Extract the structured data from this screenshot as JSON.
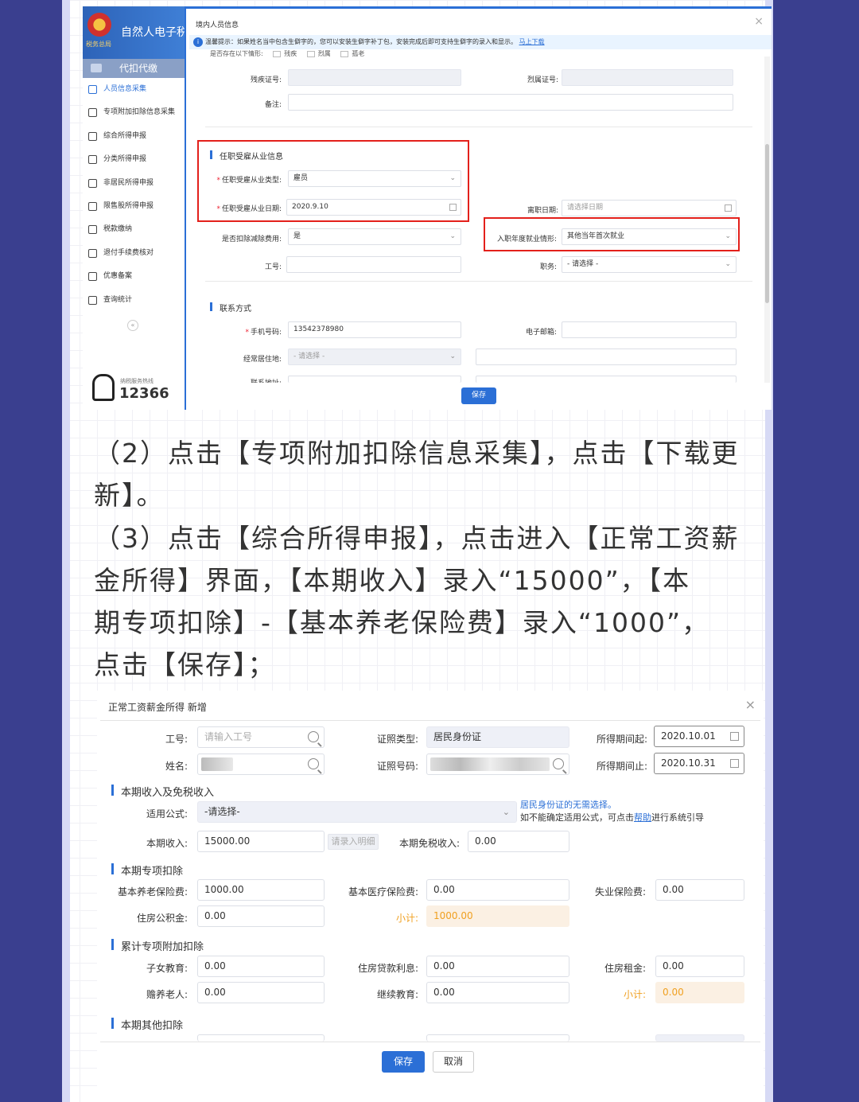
{
  "shot1": {
    "sidebar": {
      "brand": "自然人电子税",
      "emblem_sub": "税务总局",
      "tab": "代扣代缴",
      "items": [
        {
          "label": "人员信息采集",
          "icon": "user-icon",
          "active": true
        },
        {
          "label": "专项附加扣除信息采集",
          "icon": "grid-list-icon"
        },
        {
          "label": "综合所得申报",
          "icon": "layers-icon"
        },
        {
          "label": "分类所得申报",
          "icon": "pie-icon"
        },
        {
          "label": "非居民所得申报",
          "icon": "person-icon"
        },
        {
          "label": "限售股所得申报",
          "icon": "bars-icon"
        },
        {
          "label": "税款缴纳",
          "icon": "wallet-icon"
        },
        {
          "label": "退付手续费核对",
          "icon": "document-icon"
        },
        {
          "label": "优惠备案",
          "icon": "file-icon"
        },
        {
          "label": "查询统计",
          "icon": "search-list-icon"
        }
      ],
      "collapse": "«",
      "hotline_small": "纳税服务热线",
      "hotline_number": "12366"
    },
    "dialog": {
      "title": "境内人员信息",
      "close": "×",
      "notice_text": "温馨提示：如果姓名当中包含生僻字的，您可以安装生僻字补丁包，安装完成后即可支持生僻字的录入和显示。",
      "notice_link": "马上下载",
      "cut_row_label": "是否存在以下情形:",
      "cut_row_options": [
        "残疾",
        "烈属",
        "孤老"
      ],
      "disability_label": "残疾证号:",
      "martyr_label": "烈属证号:",
      "remark_label": "备注:",
      "employment_section": "任职受雇从业信息",
      "employment_type_label": "任职受雇从业类型:",
      "employment_type_value": "雇员",
      "employment_date_label": "任职受雇从业日期:",
      "employment_date_value": "2020.9.10",
      "leave_date_label": "离职日期:",
      "leave_date_placeholder": "请选择日期",
      "deduct_label": "是否扣除减除费用:",
      "deduct_value": "是",
      "entry_situation_label": "入职年度就业情形:",
      "entry_situation_value": "其他当年首次就业",
      "job_no_label": "工号:",
      "position_label": "职务:",
      "position_placeholder": "- 请选择 -",
      "contact_section": "联系方式",
      "phone_label": "手机号码:",
      "phone_value": "13542378980",
      "email_label": "电子邮箱:",
      "residence_label": "经常居住地:",
      "residence_placeholder": "- 请选择 -",
      "cut_bottom_label": "联系地址:",
      "save": "保存"
    }
  },
  "text": {
    "p2_line1": "（2）点击【专项附加扣除信息采集】，点击【下载更",
    "p2_line2": "新】。",
    "p3_line1": "（3）点击【综合所得申报】，点击进入【正常工资薪",
    "p3_line2": "金所得】界面，【本期收入】录入“15000”，【本",
    "p3_line3": "期专项扣除】-【基本养老保险费】录入“1000”，",
    "p3_line4": "点击【保存】；"
  },
  "shot2": {
    "title": "正常工资薪金所得 新增",
    "close": "×",
    "job_no_label": "工号:",
    "job_no_placeholder": "请输入工号",
    "id_type_label": "证照类型:",
    "id_type_value": "居民身份证",
    "period_start_label": "所得期间起:",
    "period_start_value": "2020.10.01",
    "name_label": "姓名:",
    "id_no_label": "证照号码:",
    "period_end_label": "所得期间止:",
    "period_end_value": "2020.10.31",
    "sec_income": "本期收入及免税收入",
    "formula_label": "适用公式:",
    "formula_placeholder": "-请选择-",
    "hint_blue": "居民身份证的无需选择。",
    "hint_text": "如不能确定适用公式，可点击",
    "hint_link": "帮助",
    "hint_tail": "进行系统引导",
    "income_label": "本期收入:",
    "income_value": "15000.00",
    "income_detail_btn": "请录入明细",
    "tax_free_label": "本期免税收入:",
    "tax_free_value": "0.00",
    "sec_special": "本期专项扣除",
    "pension_label": "基本养老保险费:",
    "pension_value": "1000.00",
    "medical_label": "基本医疗保险费:",
    "medical_value": "0.00",
    "unemployment_label": "失业保险费:",
    "unemployment_value": "0.00",
    "housing_fund_label": "住房公积金:",
    "housing_fund_value": "0.00",
    "subtotal_label": "小计:",
    "subtotal_value": "1000.00",
    "sec_cumulative": "累计专项附加扣除",
    "child_edu_label": "子女教育:",
    "child_edu_value": "0.00",
    "mortgage_label": "住房贷款利息:",
    "mortgage_value": "0.00",
    "rent_label": "住房租金:",
    "rent_value": "0.00",
    "elderly_label": "赡养老人:",
    "elderly_value": "0.00",
    "cont_edu_label": "继续教育:",
    "cont_edu_value": "0.00",
    "subtotal2_label": "小计:",
    "subtotal2_value": "0.00",
    "sec_other": "本期其他扣除",
    "save": "保存",
    "cancel": "取消"
  }
}
